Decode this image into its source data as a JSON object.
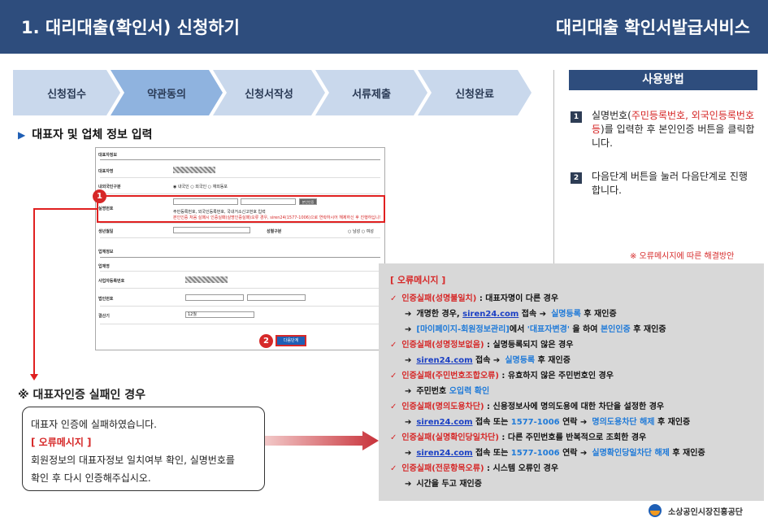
{
  "header": {
    "title": "1. 대리대출(확인서) 신청하기",
    "service": "대리대출 확인서발급서비스"
  },
  "steps": [
    "신청접수",
    "약관동의",
    "신청서작성",
    "서류제출",
    "신청완료"
  ],
  "section_title": "대표자 및 업체 정보 입력",
  "form": {
    "rep_section": "대표자정보",
    "rep_name": "대표자명",
    "nationality": "내외국인구분",
    "nationality_opts": "◉ 내국인 ○ 외국인 ○ 재외동포",
    "id_number": "실명번호",
    "verify_btn": "본인인증",
    "id_help": "주민등록번호, 외국인등록번호, 국내거소신고번호 입력",
    "id_warn": "본인인증 처음 실패시 인증실패(실명인증실패)오류 경우, siren24(1577-1006)으로 연락하시어 해제하신 후 진행하십니다.",
    "birth": "생년월일",
    "gender": "성별구분",
    "gender_opts": "○ 남성 ○ 여성",
    "biz_section": "업체정보",
    "biz_name": "업체명",
    "biz_reg": "사업자등록번호",
    "corp_reg": "법인번호",
    "settle": "결산기",
    "settle_val": "12월",
    "next_btn": "다음단계"
  },
  "badges": [
    "1",
    "2"
  ],
  "fail": {
    "title": "※ 대표자인증 실패인 경우",
    "line1": "대표자 인증에 실패하였습니다.",
    "line2": "[ 오류메시지 ]",
    "line3": "회원정보의 대표자정보 일치여부 확인, 실명번호를",
    "line4": "확인 후 다시 인증해주십시오."
  },
  "usage": {
    "title": "사용방법",
    "item1_pre": "실명번호(",
    "item1_red": "주민등록번호, 외국인등록번호 등",
    "item1_post": ")를 입력한 후 본인인증 버튼을 클릭합니다.",
    "item2": "다음단계 버튼을 눌러 다음단계로 진행합니다.",
    "note": "※ 오류메시지에 따른 해결방안"
  },
  "errors": {
    "head": "[ 오류메시지 ]",
    "e1": "인증실패(성명불일치)",
    "e1_desc": " : 대표자명이 다른 경우",
    "e1a_pre": "개명한 경우, ",
    "e1a_link": "siren24.com",
    "e1a_mid": " 접속 ",
    "e1a_blue": "실명등록",
    "e1a_post": " 후 재인증",
    "e1b_blue": "[마이페이지-회원정보관리]",
    "e1b_mid": "에서 ",
    "e1b_blue2": "'대표자변경'",
    "e1b_mid2": " 을 하여 ",
    "e1b_blue3": "본인인증",
    "e1b_post": " 후 재인증",
    "e2": "인증실패(성명정보없음)",
    "e2_desc": " : 실명등록되지 않은 경우",
    "e2a_link": "siren24.com",
    "e2a_mid": " 접속 ",
    "e2a_blue": "실명등록",
    "e2a_post": " 후 재인증",
    "e3": "인증실패(주민번호조합오류)",
    "e3_desc": " : 유효하지 않은 주민번호인 경우",
    "e3a_pre": "주민번호 ",
    "e3a_blue": "오입력 확인",
    "e4": "인증실패(명의도용차단)",
    "e4_desc": " :  신용정보사에 명의도용에 대한 차단을 설정한 경우",
    "e4a_link": "siren24.com",
    "e4a_mid": " 접속 또는 ",
    "e4a_blue": "1577-1006",
    "e4a_mid2": " 연락 ",
    "e4a_blue2": "명의도용차단 해제",
    "e4a_post": " 후 재인증",
    "e5": "인증실패(실명확인당일차단)",
    "e5_desc": " : 다른 주민번호를 반복적으로 조회한 경우",
    "e5a_link": "siren24.com",
    "e5a_mid": " 접속 또는 ",
    "e5a_blue": "1577-1006",
    "e5a_mid2": " 연락 ",
    "e5a_blue2": "실명확인당일차단 해제",
    "e5a_post": " 후 재인증",
    "e6": "인증실패(전문항목오류)",
    "e6_desc": " : 시스템 오류인 경우",
    "e6a": "시간을 두고 재인증"
  },
  "logo": "소상공인시장진흥공단",
  "colors": {
    "header": "#2e4d7d",
    "accent_red": "#d62828",
    "link_blue": "#1f7ad8",
    "step_fill": "#c9d8ec",
    "step_active": "#8fb3df"
  }
}
